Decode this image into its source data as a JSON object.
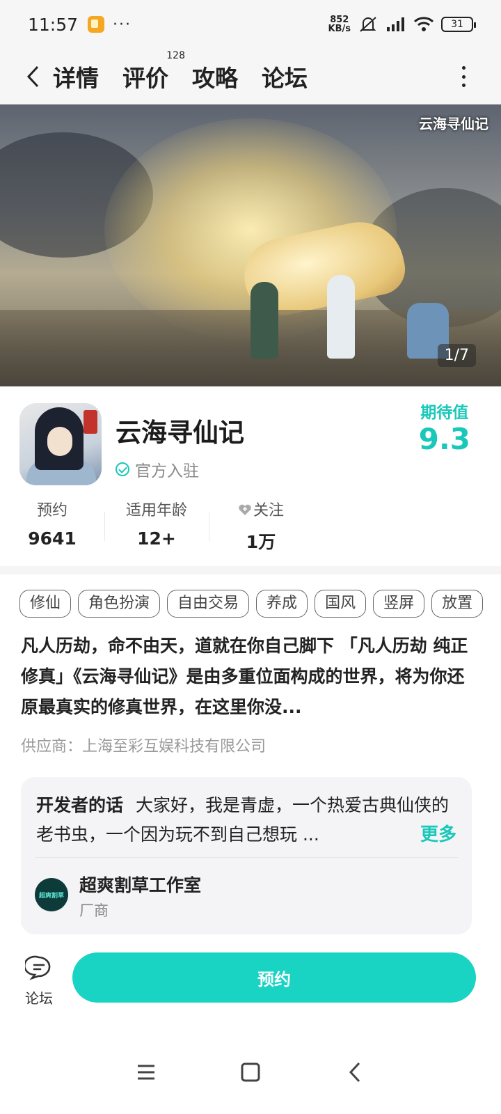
{
  "status_bar": {
    "time": "11:57",
    "more": "···",
    "net_speed_value": "852",
    "net_speed_unit": "KB/s",
    "battery": "31"
  },
  "nav": {
    "tabs": [
      {
        "label": "详情",
        "active": true
      },
      {
        "label": "评价",
        "badge": "128"
      },
      {
        "label": "攻略"
      },
      {
        "label": "论坛"
      }
    ]
  },
  "banner": {
    "logo_text": "云海寻仙记",
    "counter": "1/7"
  },
  "game": {
    "title": "云海寻仙记",
    "verified_label": "官方入驻",
    "expect_label": "期待值",
    "expect_value": "9.3",
    "stats": [
      {
        "label": "预约",
        "value": "9641"
      },
      {
        "label": "适用年龄",
        "value": "12+"
      },
      {
        "label": "关注",
        "value": "1万"
      }
    ]
  },
  "tags": [
    "修仙",
    "角色扮演",
    "自由交易",
    "养成",
    "国风",
    "竖屏",
    "放置"
  ],
  "description": "凡人历劫，命不由天，道就在你自己脚下 「凡人历劫 纯正修真」《云海寻仙记》是由多重位面构成的世界，将为你还原最真实的修真世界，在这里你没...",
  "supplier": "供应商：上海至彩互娱科技有限公司",
  "developer": {
    "words_title": "开发者的话",
    "words_text": "大家好，我是青虚，一个热爱古典仙侠的老书虫，一个因为玩不到自己想玩 ...",
    "more_label": "更多",
    "studio_name": "超爽割草工作室",
    "studio_role": "厂商",
    "studio_logo_text": "超爽割草"
  },
  "bottom": {
    "forum_label": "论坛",
    "reserve_label": "预约"
  },
  "colors": {
    "accent": "#19c8b9",
    "button": "#19d3c3"
  }
}
